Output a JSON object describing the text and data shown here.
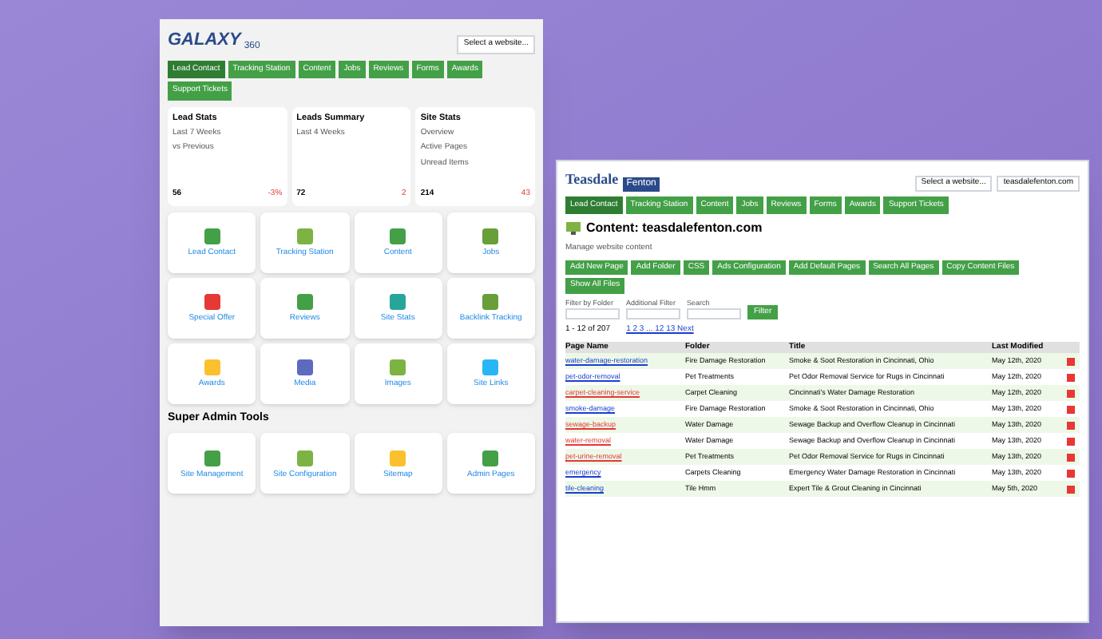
{
  "galaxy": {
    "logo": "GALAXY",
    "logo_sub": "360",
    "nav": [
      {
        "label": "Lead Contact",
        "selected": true
      },
      {
        "label": "Tracking Station",
        "selected": false
      },
      {
        "label": "Content",
        "selected": false
      },
      {
        "label": "Jobs",
        "selected": false
      },
      {
        "label": "Reviews",
        "selected": false
      },
      {
        "label": "Forms",
        "selected": false
      },
      {
        "label": "Awards",
        "selected": false
      },
      {
        "label": "Support Tickets",
        "selected": false
      }
    ],
    "website_select": "Select a website...",
    "cards": [
      {
        "title": "Lead Stats",
        "lines": [
          "Last 7 Weeks",
          "vs Previous"
        ],
        "value": "56",
        "change": "-3%"
      },
      {
        "title": "Leads Summary",
        "lines": [
          "Last 4 Weeks"
        ],
        "value": "72",
        "change": "2"
      },
      {
        "title": "Site Stats",
        "lines": [
          "Overview",
          "Active Pages",
          "Unread Items"
        ],
        "value": "214",
        "change": "43"
      }
    ],
    "tiles": [
      {
        "label": "Lead Contact",
        "color": "#43a047"
      },
      {
        "label": "Tracking Station",
        "color": "#7cb342"
      },
      {
        "label": "Content",
        "color": "#43a047"
      },
      {
        "label": "Jobs",
        "color": "#689f38"
      },
      {
        "label": "Special Offer",
        "color": "#e53935"
      },
      {
        "label": "Reviews",
        "color": "#43a047"
      },
      {
        "label": "Site Stats",
        "color": "#26a69a"
      },
      {
        "label": "Backlink Tracking",
        "color": "#689f38"
      },
      {
        "label": "Awards",
        "color": "#fbc02d"
      },
      {
        "label": "Media",
        "color": "#5c6bc0"
      },
      {
        "label": "Images",
        "color": "#7cb342"
      },
      {
        "label": "Site Links",
        "color": "#29b6f6"
      }
    ],
    "section_title": "Super Admin Tools",
    "admin_tiles": [
      {
        "label": "Site Management",
        "color": "#43a047"
      },
      {
        "label": "Site Configuration",
        "color": "#7cb342"
      },
      {
        "label": "Sitemap",
        "color": "#fbc02d"
      },
      {
        "label": "Admin Pages",
        "color": "#43a047"
      }
    ]
  },
  "teasdale": {
    "logo": "Teasdale",
    "logo_2": "Fenton",
    "website_select": "Select a website...",
    "domain": "teasdalefenton.com",
    "nav": [
      {
        "label": "Lead Contact",
        "selected": true
      },
      {
        "label": "Tracking Station",
        "selected": false
      },
      {
        "label": "Content",
        "selected": false
      },
      {
        "label": "Jobs",
        "selected": false
      },
      {
        "label": "Reviews",
        "selected": false
      },
      {
        "label": "Forms",
        "selected": false
      },
      {
        "label": "Awards",
        "selected": false
      },
      {
        "label": "Support Tickets",
        "selected": false
      }
    ],
    "title": "Content: teasdalefenton.com",
    "subtitle": "Manage website content",
    "actions": [
      "Add New Page",
      "Add Folder",
      "CSS",
      "Ads Configuration",
      "Add Default Pages",
      "Search All Pages",
      "Copy Content Files",
      "Show All Files"
    ],
    "filters": [
      {
        "label": "Filter by Folder"
      },
      {
        "label": "Additional Filter"
      },
      {
        "label": "Search"
      }
    ],
    "filter_button": "Filter",
    "count": "1 - 12 of 207",
    "pages": "1 2 3 ... 12 13 Next",
    "columns": [
      "Page Name",
      "Folder",
      "Title",
      "Last Modified"
    ],
    "rows": [
      {
        "name": "water-damage-restoration",
        "flagged": false,
        "folder": "Fire Damage Restoration",
        "title": "Smoke & Soot Restoration in Cincinnati, Ohio",
        "date": "May 12th, 2020"
      },
      {
        "name": "pet-odor-removal",
        "flagged": false,
        "folder": "Pet Treatments",
        "title": "Pet Odor Removal Service for Rugs in Cincinnati",
        "date": "May 12th, 2020"
      },
      {
        "name": "carpet-cleaning-service",
        "flagged": true,
        "folder": "Carpet Cleaning",
        "title": "Cincinnati's Water Damage Restoration",
        "date": "May 12th, 2020"
      },
      {
        "name": "smoke-damage",
        "flagged": false,
        "folder": "Fire Damage Restoration",
        "title": "Smoke & Soot Restoration in Cincinnati, Ohio",
        "date": "May 13th, 2020"
      },
      {
        "name": "sewage-backup",
        "flagged": true,
        "folder": "Water Damage",
        "title": "Sewage Backup and Overflow Cleanup in Cincinnati",
        "date": "May 13th, 2020"
      },
      {
        "name": "water-removal",
        "flagged": true,
        "folder": "Water Damage",
        "title": "Sewage Backup and Overflow Cleanup in Cincinnati",
        "date": "May 13th, 2020"
      },
      {
        "name": "pet-urine-removal",
        "flagged": true,
        "folder": "Pet Treatments",
        "title": "Pet Odor Removal Service for Rugs in Cincinnati",
        "date": "May 13th, 2020"
      },
      {
        "name": "emergency",
        "flagged": false,
        "folder": "Carpets Cleaning",
        "title": "Emergency Water Damage Restoration in Cincinnati",
        "date": "May 13th, 2020"
      },
      {
        "name": "tile-cleaning",
        "flagged": false,
        "folder": "Tile Hmm",
        "title": "Expert Tile & Grout Cleaning in Cincinnati",
        "date": "May 5th, 2020"
      }
    ]
  }
}
